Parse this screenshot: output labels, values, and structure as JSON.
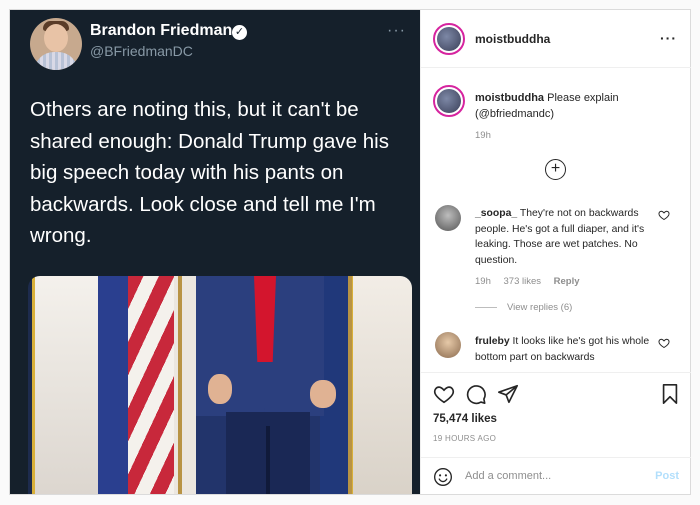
{
  "tweet": {
    "name": "Brandon Friedman",
    "handle": "@BFriedmanDC",
    "more_icon": "more-dots-icon",
    "text": "Others are noting this, but it can't be shared enough: Donald Trump gave his big speech today with his pants on backwards. Look close and tell me I'm wrong."
  },
  "post": {
    "username": "moistbuddha",
    "caption_text": "Please explain (@bfriedmandc)",
    "caption_time": "19h",
    "likes": "75,474 likes",
    "time": "19 HOURS AGO"
  },
  "comments": [
    {
      "username": "_soopa_",
      "text": "They're not on backwards people. He's got a full diaper, and it's leaking. Those are wet patches. No question.",
      "time": "19h",
      "likes": "373 likes",
      "reply_label": "Reply",
      "view_replies": "View replies (6)"
    },
    {
      "username": "fruleby",
      "text": "It looks like he's got his whole bottom part on backwards"
    }
  ],
  "composer": {
    "placeholder": "Add a comment...",
    "post_label": "Post"
  },
  "colors": {
    "tweet_bg": "#15202b",
    "post_disabled": "#b2dffc",
    "story_ring": "#d6249f"
  }
}
